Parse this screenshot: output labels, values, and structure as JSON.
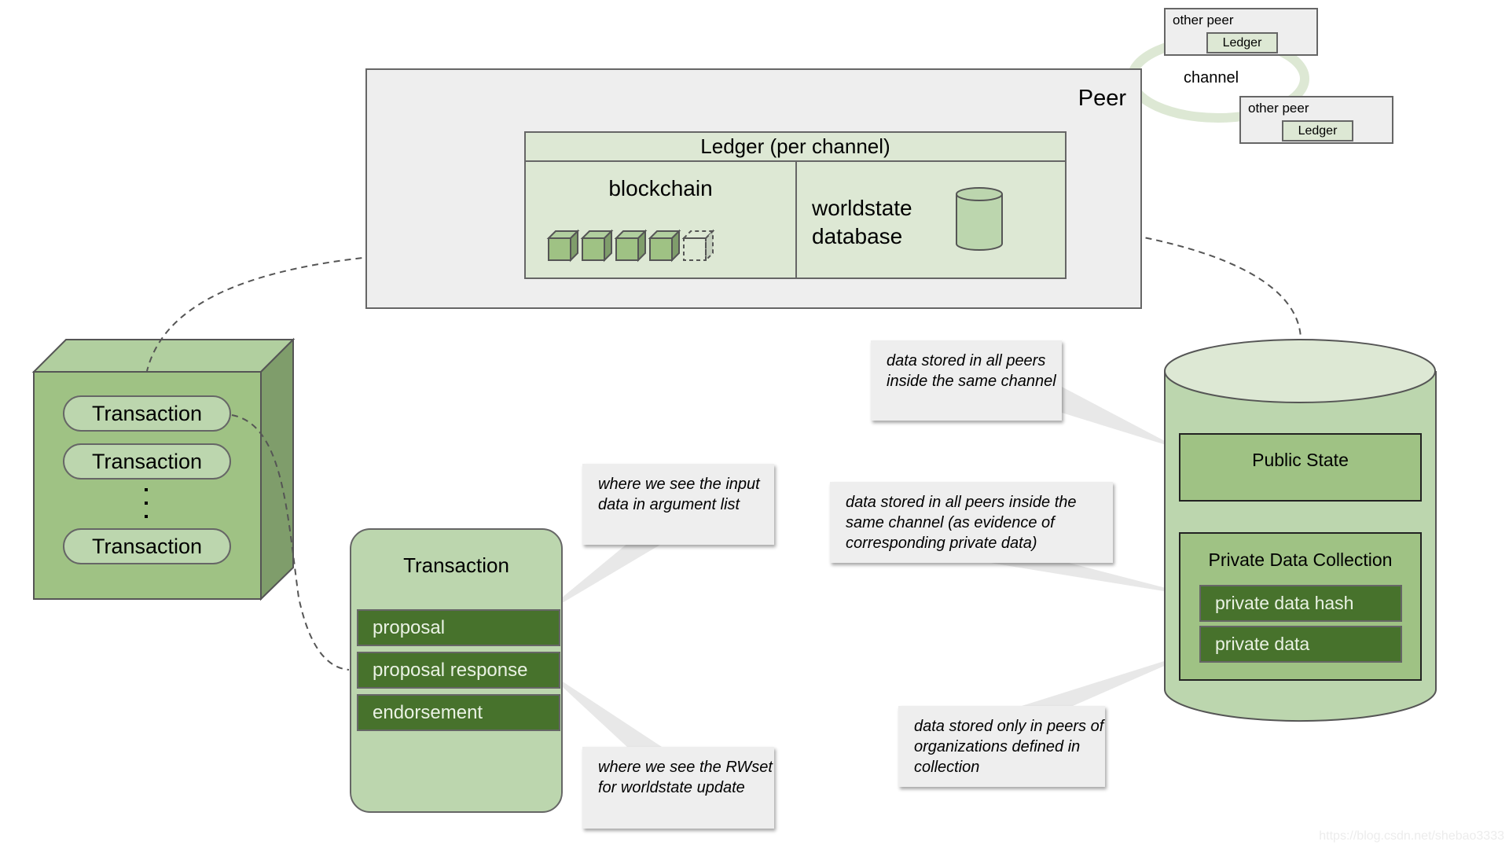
{
  "peer": {
    "title": "Peer",
    "ledger": {
      "title": "Ledger (per channel)",
      "blockchain_label": "blockchain",
      "blocks": 4,
      "pending_blocks": 1,
      "worldstate_label": "worldstate database"
    }
  },
  "channel": {
    "label": "channel",
    "other_peers": [
      {
        "name": "other peer",
        "ledger_label": "Ledger"
      },
      {
        "name": "other peer",
        "ledger_label": "Ledger"
      }
    ]
  },
  "block": {
    "transactions": [
      "Transaction",
      "Transaction",
      "Transaction"
    ],
    "ellipsis": "⋮"
  },
  "transaction_detail": {
    "title": "Transaction",
    "rows": [
      "proposal",
      "proposal response",
      "endorsement"
    ]
  },
  "callouts": {
    "proposal": "where we see the input data in argument list",
    "proposal_response": "where we see the RWset for worldstate update",
    "public_state": "data stored in all peers inside the same channel",
    "private_hash": "data stored in all peers inside the same channel (as evidence of corresponding private data)",
    "private_data": "data stored only in peers of organizations defined in collection"
  },
  "state_db": {
    "public_state": "Public State",
    "pdc_title": "Private Data Collection",
    "pdc_rows": [
      "private data hash",
      "private data"
    ]
  },
  "colors": {
    "light_green": "#dde8d4",
    "mid_green": "#bcd6ae",
    "green": "#9fc284",
    "dark_green": "#47722c",
    "side_green": "#7f9d6b",
    "panel_gray": "#eeeeee",
    "stroke": "#666666"
  },
  "watermark": "https://blog.csdn.net/shebao3333"
}
